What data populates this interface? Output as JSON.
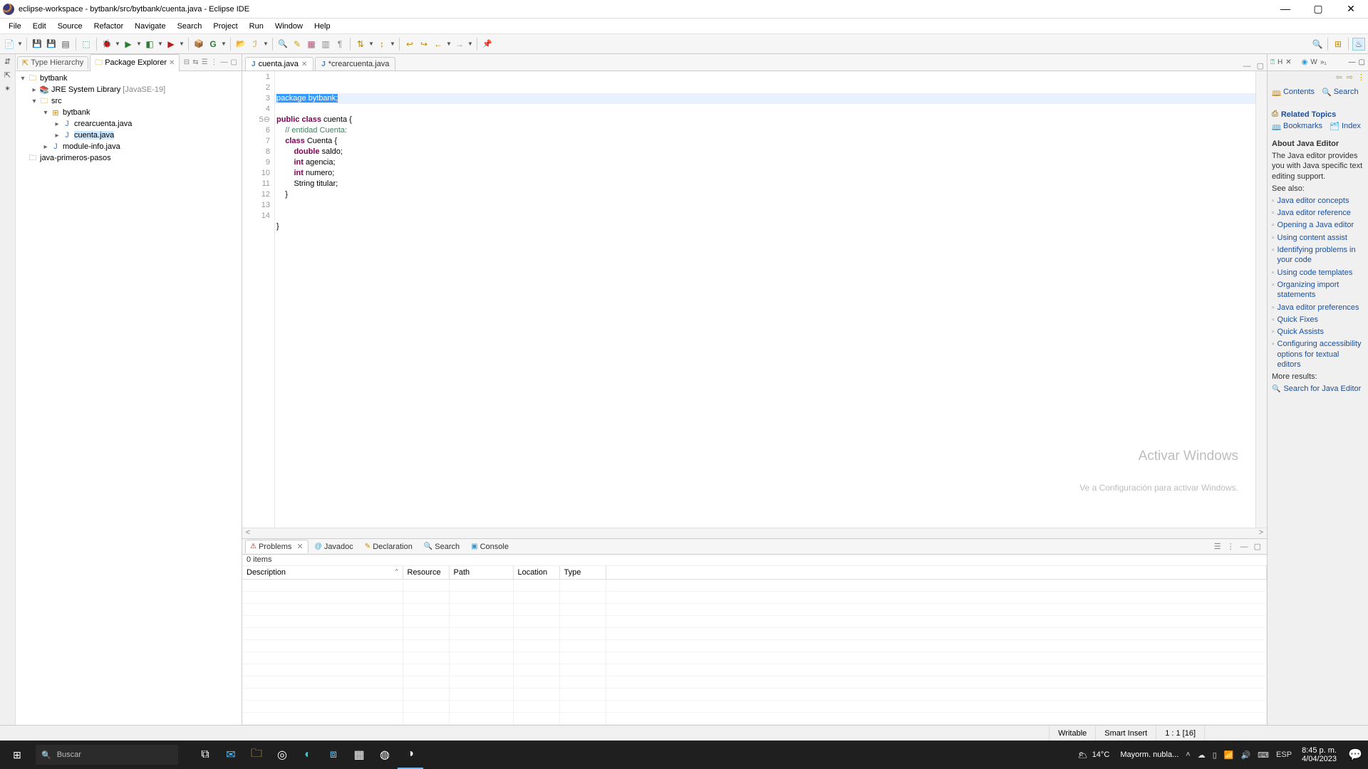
{
  "title": "eclipse-workspace - bytbank/src/bytbank/cuenta.java - Eclipse IDE",
  "menu": [
    "File",
    "Edit",
    "Source",
    "Refactor",
    "Navigate",
    "Search",
    "Project",
    "Run",
    "Window",
    "Help"
  ],
  "explorer": {
    "tab_hierarchy": "Type Hierarchy",
    "tab_explorer": "Package Explorer",
    "tree": {
      "proj": "bytbank",
      "jre": "JRE System Library",
      "jre_suffix": "[JavaSE-19]",
      "src": "src",
      "pkg": "bytbank",
      "f1": "crearcuenta.java",
      "f2": "cuenta.java",
      "f3": "module-info.java",
      "proj2": "java-primeros-pasos"
    }
  },
  "editor": {
    "tab1": "cuenta.java",
    "tab2": "*crearcuenta.java",
    "lines": [
      {
        "n": "1",
        "html": "<span class='sel'>package bytbank;</span>",
        "hl": true
      },
      {
        "n": "2",
        "html": ""
      },
      {
        "n": "3",
        "html": "<span class='kw'>public</span> <span class='kw'>class</span> cuenta {"
      },
      {
        "n": "4",
        "html": "    <span class='cm'>// entidad Cuenta:</span>"
      },
      {
        "n": "5⊖",
        "html": "    <span class='kw'>class</span> Cuenta {"
      },
      {
        "n": "6",
        "html": "        <span class='kw'>double</span> saldo;"
      },
      {
        "n": "7",
        "html": "        <span class='kw'>int</span> agencia;"
      },
      {
        "n": "8",
        "html": "        <span class='kw'>int</span> numero;"
      },
      {
        "n": "9",
        "html": "        String titular;"
      },
      {
        "n": "10",
        "html": "    }"
      },
      {
        "n": "11",
        "html": ""
      },
      {
        "n": "12",
        "html": ""
      },
      {
        "n": "13",
        "html": "}"
      },
      {
        "n": "14",
        "html": ""
      }
    ]
  },
  "problems": {
    "tabs": [
      "Problems",
      "Javadoc",
      "Declaration",
      "Search",
      "Console"
    ],
    "status": "0 items",
    "cols": [
      "Description",
      "Resource",
      "Path",
      "Location",
      "Type"
    ]
  },
  "help": {
    "tab_h": "H",
    "tab_w": "W",
    "contents": "Contents",
    "search": "Search",
    "related": "Related Topics",
    "bookmarks": "Bookmarks",
    "index": "Index",
    "about_h": "About Java Editor",
    "about_t": "The Java editor provides you with Java specific text editing support.",
    "see": "See also:",
    "links": [
      "Java editor concepts",
      "Java editor reference",
      "Opening a Java editor",
      "Using content assist",
      "Identifying problems in your code",
      "Using code templates",
      "Organizing import statements",
      "Java editor preferences",
      "Quick Fixes",
      "Quick Assists",
      "Configuring accessibility options for textual editors"
    ],
    "more": "More results:",
    "more_link": "Search for Java Editor"
  },
  "status": {
    "writable": "Writable",
    "insert": "Smart Insert",
    "pos": "1 : 1 [16]"
  },
  "watermark": {
    "t1": "Activar Windows",
    "t2": "Ve a Configuración para activar Windows."
  },
  "taskbar": {
    "search": "Buscar",
    "weather_t": "14°C",
    "weather_d": "Mayorm. nubla...",
    "lang": "ESP",
    "time": "8:45 p. m.",
    "date": "4/04/2023"
  }
}
